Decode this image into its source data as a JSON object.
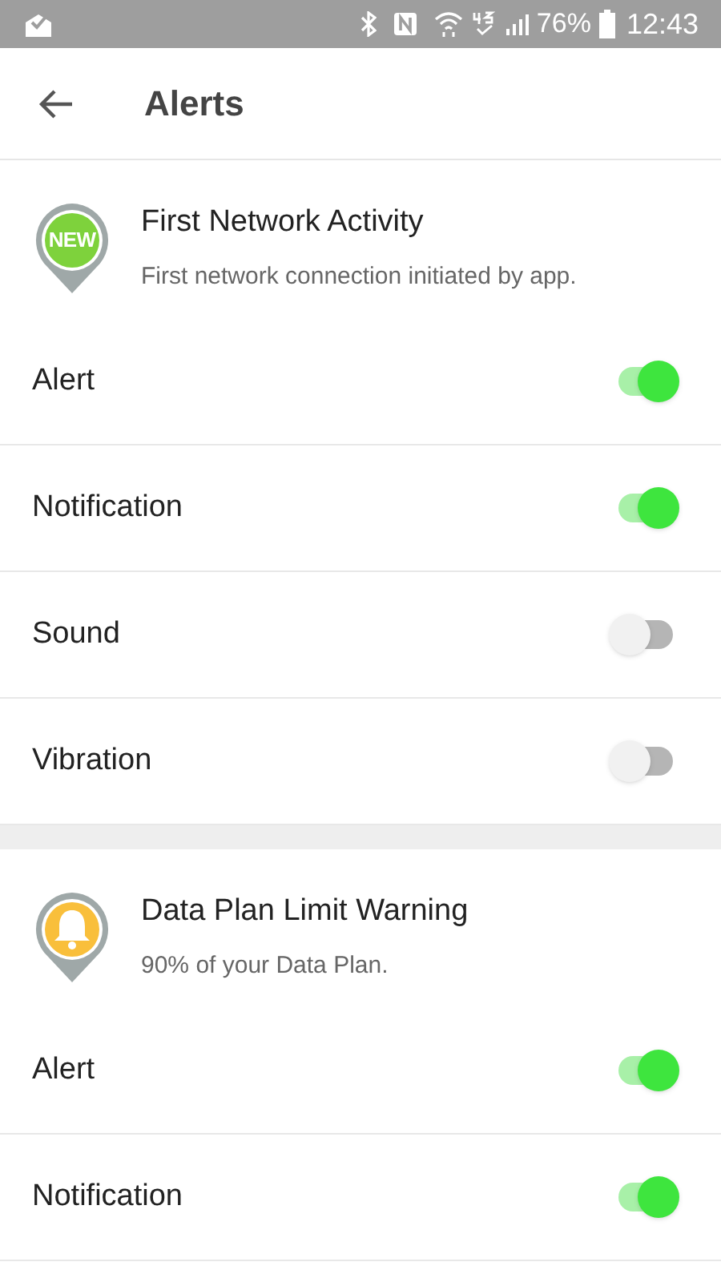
{
  "status_bar": {
    "battery": "76%",
    "time": "12:43"
  },
  "app_bar": {
    "title": "Alerts"
  },
  "sections": [
    {
      "title": "First Network Activity",
      "subtitle": "First network connection initiated by app.",
      "badge": {
        "kind": "text",
        "text": "NEW",
        "color": "#7ed23c"
      },
      "settings": [
        {
          "label": "Alert",
          "on": true
        },
        {
          "label": "Notification",
          "on": true
        },
        {
          "label": "Sound",
          "on": false
        },
        {
          "label": "Vibration",
          "on": false
        }
      ]
    },
    {
      "title": "Data Plan Limit Warning",
      "subtitle": "90% of your Data Plan.",
      "badge": {
        "kind": "bell",
        "color": "#f9bf3b"
      },
      "settings": [
        {
          "label": "Alert",
          "on": true
        },
        {
          "label": "Notification",
          "on": true
        }
      ]
    }
  ]
}
